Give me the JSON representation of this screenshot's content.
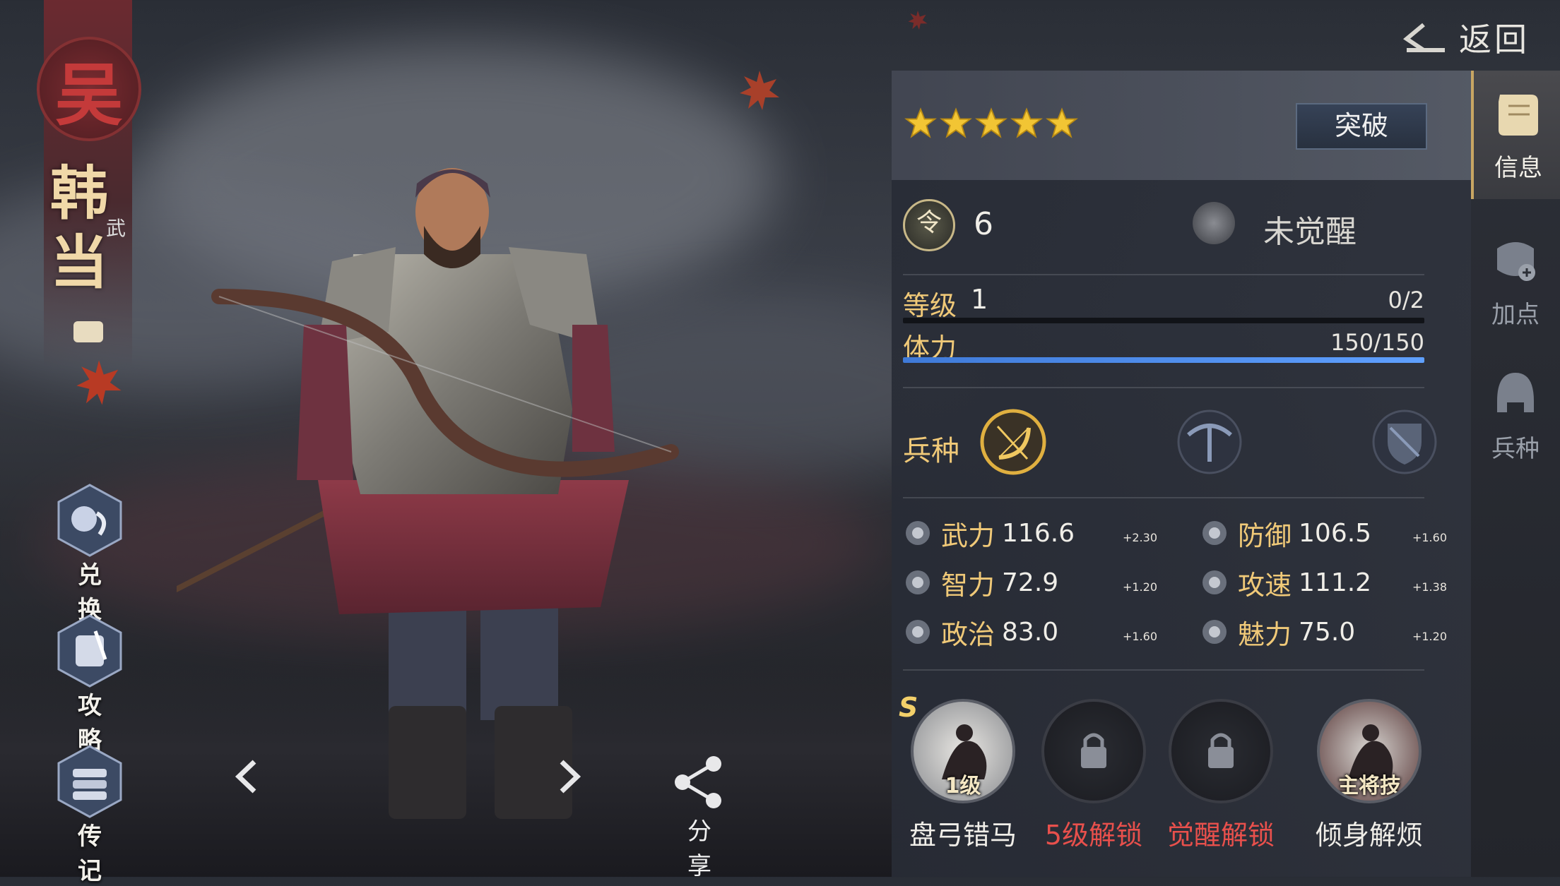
{
  "hero": {
    "faction": "吴",
    "name_line1": "韩",
    "name_line2": "当",
    "type": "武"
  },
  "left_menu": [
    {
      "label": "兑 换",
      "icon": "exchange-icon"
    },
    {
      "label": "攻 略",
      "icon": "scroll-quill-icon"
    },
    {
      "label": "传 记",
      "icon": "book-stack-icon"
    }
  ],
  "nav": {
    "prev_icon": "chevron-left-icon",
    "next_icon": "chevron-right-icon",
    "share_label": "分 享"
  },
  "header": {
    "back_label": "返回"
  },
  "tabs": [
    {
      "label": "信息",
      "icon": "scroll-icon",
      "active": true
    },
    {
      "label": "加点",
      "icon": "armor-plus-icon",
      "active": false
    },
    {
      "label": "兵种",
      "icon": "helmet-icon",
      "active": false
    }
  ],
  "panel": {
    "stars": 5,
    "breakthrough_label": "突破",
    "command_icon": "令",
    "command_value": "6",
    "awaken_status": "未觉醒",
    "level_label": "等级",
    "level_value": "1",
    "level_progress": "0/2",
    "level_fraction": 0.0,
    "stamina_label": "体力",
    "stamina_value": "150/150",
    "stamina_fraction": 1.0,
    "troop_label": "兵种",
    "troops": [
      "bow-icon",
      "crossbow-icon",
      "shield-crossbow-icon"
    ]
  },
  "stats": [
    {
      "name": "武力",
      "value": "116.6",
      "bonus": "+2.30",
      "icon": "swords-icon"
    },
    {
      "name": "防御",
      "value": "106.5",
      "bonus": "+1.60",
      "icon": "shield-icon"
    },
    {
      "name": "智力",
      "value": "72.9",
      "bonus": "+1.20",
      "icon": "bamboo-scroll-icon"
    },
    {
      "name": "攻速",
      "value": "111.2",
      "bonus": "+1.38",
      "icon": "boot-icon"
    },
    {
      "name": "政治",
      "value": "83.0",
      "bonus": "+1.60",
      "icon": "lotus-icon"
    },
    {
      "name": "魅力",
      "value": "75.0",
      "bonus": "+1.20",
      "icon": "heart-icon"
    }
  ],
  "skills": [
    {
      "name": "盘弓错马",
      "grade": "S",
      "tag": "1级",
      "locked": false
    },
    {
      "name": "5级解锁",
      "grade": "",
      "tag": "",
      "locked": true
    },
    {
      "name": "觉醒解锁",
      "grade": "",
      "tag": "",
      "locked": true
    },
    {
      "name": "倾身解烦",
      "grade": "",
      "tag": "主将技",
      "locked": false
    }
  ],
  "colors": {
    "accent_gold": "#f0c978",
    "bonus_green": "#6fd16a",
    "lock_red": "#e8504c",
    "stamina_blue": "#4f8fef"
  }
}
